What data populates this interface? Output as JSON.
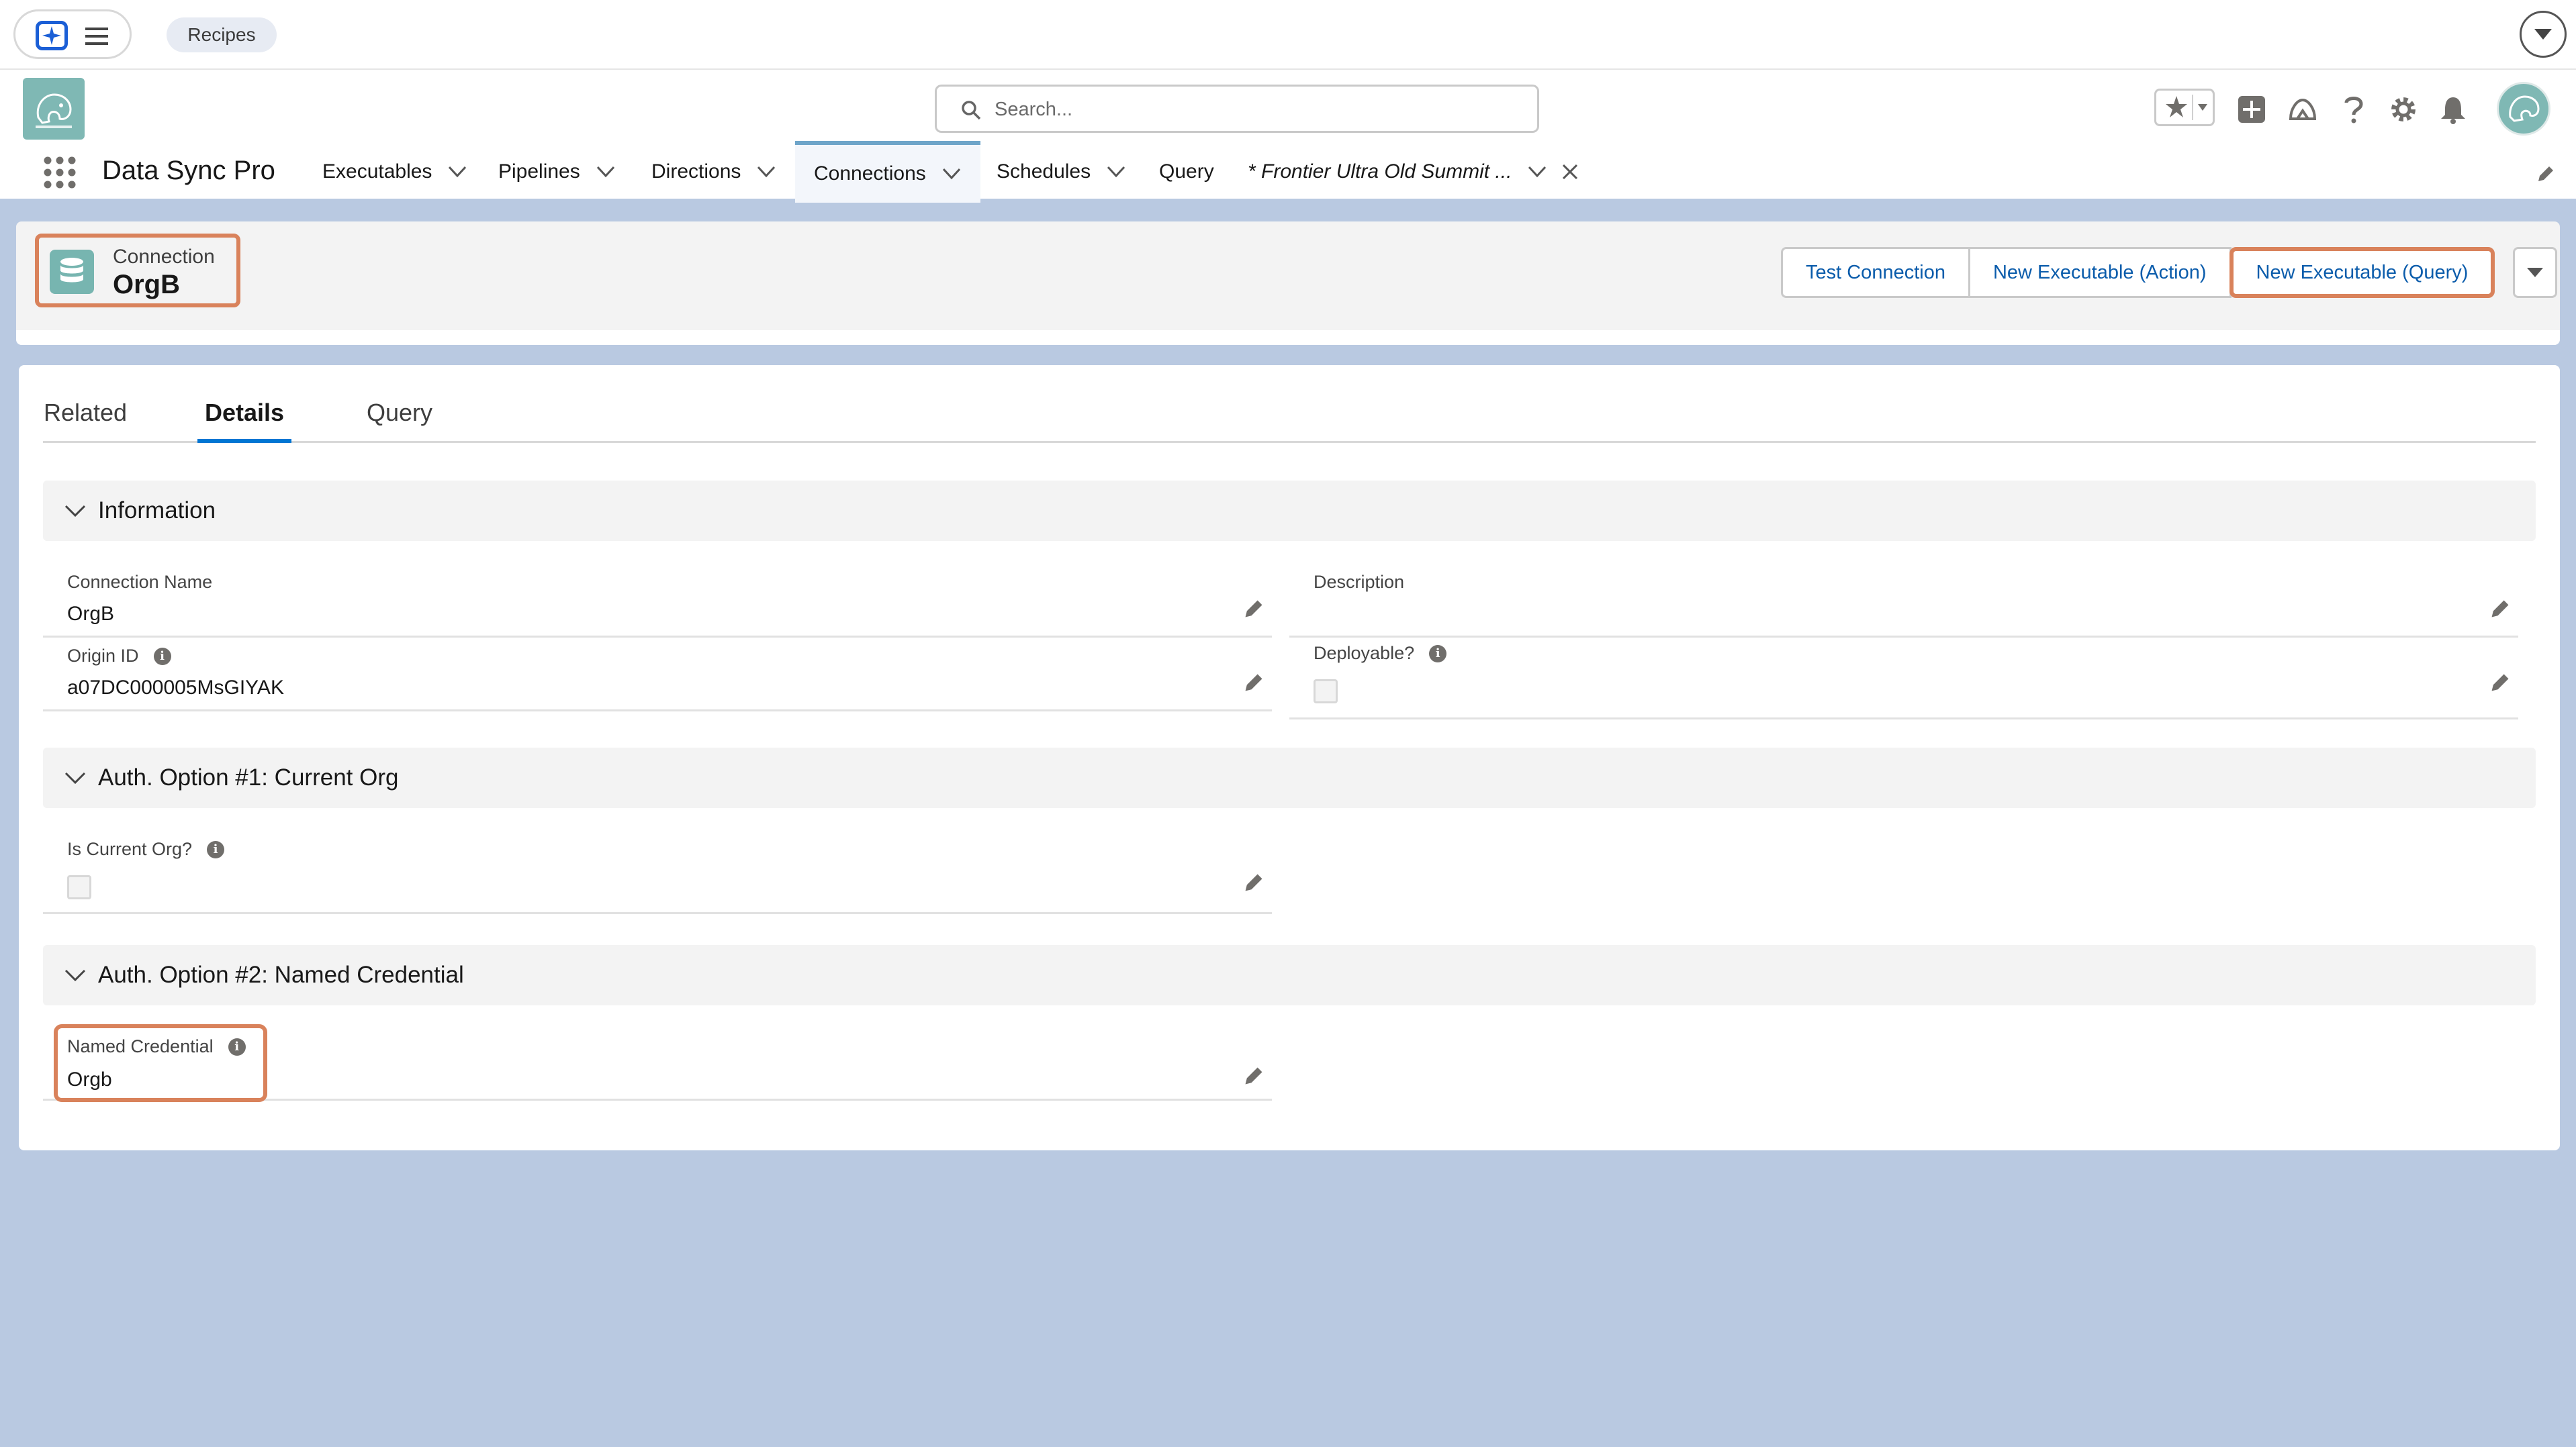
{
  "topbar": {
    "recipes_label": "Recipes",
    "icons": [
      "agent-sparkle-icon",
      "menu-icon",
      "dropdown-circle-icon"
    ]
  },
  "header": {
    "search_placeholder": "Search...",
    "icons": [
      "favorites-star-icon",
      "global-add-icon",
      "trailhead-icon",
      "help-icon",
      "setup-gear-icon",
      "notifications-bell-icon",
      "user-avatar"
    ]
  },
  "nav": {
    "app_name": "Data Sync Pro",
    "items": [
      {
        "label": "Executables",
        "has_menu": true
      },
      {
        "label": "Pipelines",
        "has_menu": true
      },
      {
        "label": "Directions",
        "has_menu": true
      },
      {
        "label": "Connections",
        "has_menu": true,
        "active": true
      },
      {
        "label": "Schedules",
        "has_menu": true
      },
      {
        "label": "Query",
        "has_menu": false
      }
    ],
    "workspace_tab": "* Frontier Ultra Old Summit ..."
  },
  "record": {
    "type_label": "Connection",
    "name": "OrgB",
    "actions": [
      "Test Connection",
      "New Executable (Action)",
      "New Executable (Query)"
    ],
    "highlighted_action": "New Executable (Query)"
  },
  "tabs": [
    {
      "label": "Related",
      "active": false
    },
    {
      "label": "Details",
      "active": true
    },
    {
      "label": "Query",
      "active": false
    }
  ],
  "sections": {
    "information": {
      "title": "Information",
      "connection_name_label": "Connection Name",
      "connection_name_value": "OrgB",
      "description_label": "Description",
      "description_value": "",
      "origin_id_label": "Origin ID",
      "origin_id_value": "a07DC000005MsGIYAK",
      "deployable_label": "Deployable?",
      "deployable_checked": false
    },
    "auth1": {
      "title": "Auth. Option #1: Current Org",
      "is_current_org_label": "Is Current Org?",
      "is_current_org_checked": false
    },
    "auth2": {
      "title": "Auth. Option #2: Named Credential",
      "named_credential_label": "Named Credential",
      "named_credential_value": "Orgb"
    }
  },
  "colors": {
    "page_bg": "#b9c9e1",
    "brand_blue": "#0176d3",
    "link_blue": "#0b5cab",
    "highlight_orange": "#d9825b",
    "record_icon_teal": "#77b5b0"
  }
}
